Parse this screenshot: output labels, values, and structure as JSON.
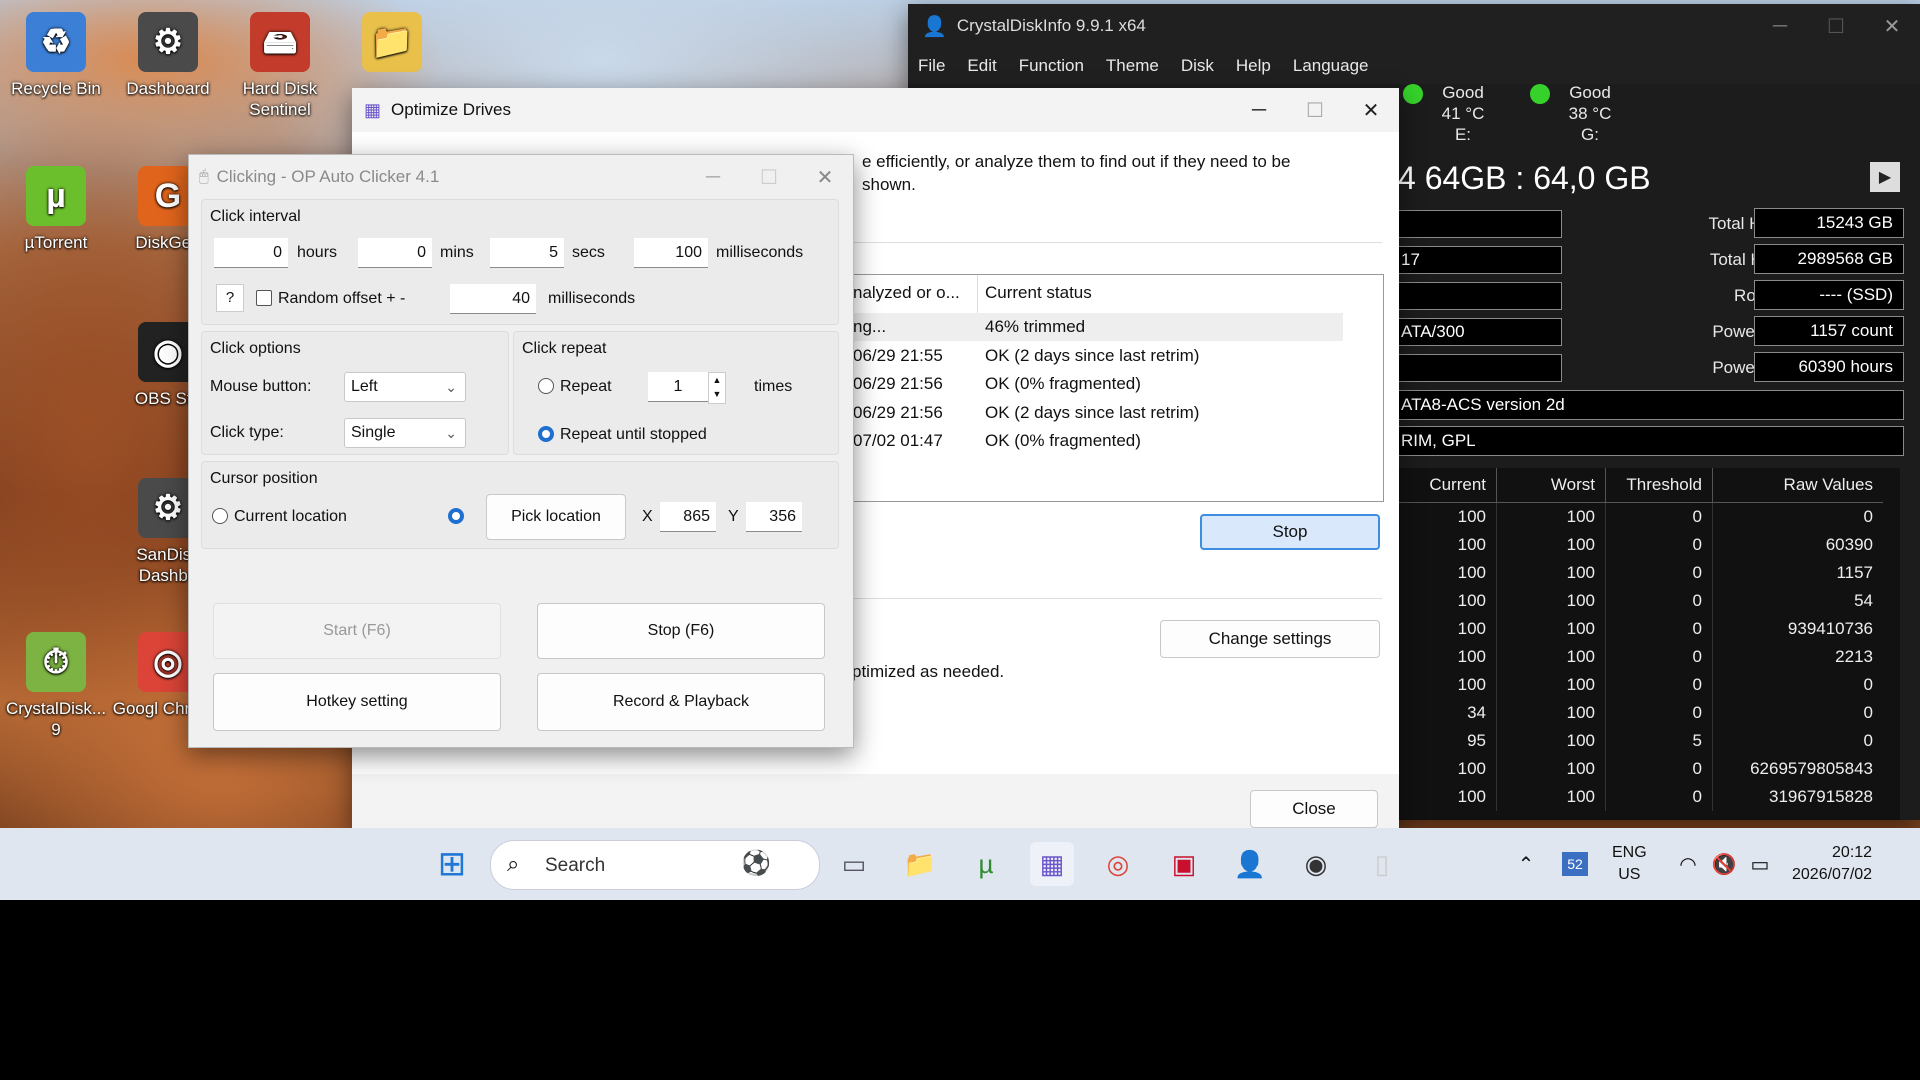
{
  "desktop": {
    "icons": [
      {
        "label": "Recycle Bin",
        "glyph": "♻",
        "color": "#3b7fd6"
      },
      {
        "label": "Dashboard",
        "glyph": "⚙",
        "color": "#4a4a4a"
      },
      {
        "label": "Hard Disk Sentinel",
        "glyph": "🖴",
        "color": "#c23b2b"
      },
      {
        "label": "",
        "glyph": "📁",
        "color": "#e8c04a"
      },
      {
        "label": "µTorrent",
        "glyph": "µ",
        "color": "#6cbf2c"
      },
      {
        "label": "DiskGen",
        "glyph": "G",
        "color": "#e0641c"
      },
      {
        "label": "OBS Stu",
        "glyph": "◉",
        "color": "#222222"
      },
      {
        "label": "SanDisk Dashbo",
        "glyph": "⚙",
        "color": "#4a4a4a"
      },
      {
        "label": "CrystalDisk... 9",
        "glyph": "⏱",
        "color": "#7cb342"
      },
      {
        "label": "Googl Chrome",
        "glyph": "◎",
        "color": "#db4437"
      }
    ]
  },
  "crystal": {
    "title": "CrystalDiskInfo 9.9.1 x64",
    "menu": [
      "File",
      "Edit",
      "Function",
      "Theme",
      "Disk",
      "Help",
      "Language"
    ],
    "drives": [
      {
        "status": "Good",
        "temp": "41 °C",
        "letter": "E:"
      },
      {
        "status": "Good",
        "temp": "38 °C",
        "letter": "G:"
      }
    ],
    "model": "4 64GB : 64,0 GB",
    "left_fields": [
      "",
      "17",
      "",
      "ATA/300",
      ""
    ],
    "stats": [
      {
        "label": "Total Host Reads",
        "value": "15243 GB"
      },
      {
        "label": "Total Host Writes",
        "value": "2989568 GB"
      },
      {
        "label": "Rotation Rate",
        "value": "---- (SSD)"
      },
      {
        "label": "Power On Count",
        "value": "1157 count"
      },
      {
        "label": "Power On Hours",
        "value": "60390 hours"
      }
    ],
    "standard": "ATA8-ACS version 2d",
    "features": "RIM, GPL",
    "smart_headers": [
      "Current",
      "Worst",
      "Threshold",
      "Raw Values"
    ],
    "smart_rows": [
      [
        "100",
        "100",
        "0",
        "0"
      ],
      [
        "100",
        "100",
        "0",
        "60390"
      ],
      [
        "100",
        "100",
        "0",
        "1157"
      ],
      [
        "100",
        "100",
        "0",
        "54"
      ],
      [
        "100",
        "100",
        "0",
        "939410736"
      ],
      [
        "100",
        "100",
        "0",
        "2213"
      ],
      [
        "100",
        "100",
        "0",
        "0"
      ],
      [
        "34",
        "100",
        "0",
        "0"
      ],
      [
        "95",
        "100",
        "5",
        "0"
      ],
      [
        "100",
        "100",
        "0",
        "6269579805843"
      ],
      [
        "100",
        "100",
        "0",
        "31967915828"
      ]
    ]
  },
  "optimize": {
    "title": "Optimize Drives",
    "desc_line1": "e efficiently, or analyze them to find out if they need to be",
    "desc_line2": "shown.",
    "col_last": "nalyzed or o...",
    "col_status": "Current status",
    "rows": [
      {
        "date": "ng...",
        "status": "46% trimmed"
      },
      {
        "date": "06/29 21:55",
        "status": "OK (2 days since last retrim)"
      },
      {
        "date": "06/29 21:56",
        "status": "OK (0% fragmented)"
      },
      {
        "date": "06/29 21:56",
        "status": "OK (2 days since last retrim)"
      },
      {
        "date": "07/02 01:47",
        "status": "OK (0% fragmented)"
      }
    ],
    "stop_label": "Stop",
    "change_settings_label": "Change settings",
    "scheduled_text": "ptimized as needed.",
    "close_label": "Close"
  },
  "clicker": {
    "title": "Clicking - OP Auto Clicker 4.1",
    "interval_title": "Click interval",
    "hours": "0",
    "hours_lbl": "hours",
    "mins": "0",
    "mins_lbl": "mins",
    "secs": "5",
    "secs_lbl": "secs",
    "ms": "100",
    "ms_lbl": "milliseconds",
    "help": "?",
    "random_lbl": "Random offset + -",
    "random_ms": "40",
    "random_ms_lbl": "milliseconds",
    "options_title": "Click options",
    "mouse_btn_lbl": "Mouse button:",
    "mouse_btn": "Left",
    "click_type_lbl": "Click type:",
    "click_type": "Single",
    "repeat_title": "Click repeat",
    "repeat_lbl": "Repeat",
    "repeat_times": "1",
    "times_lbl": "times",
    "repeat_until_lbl": "Repeat until stopped",
    "cursor_title": "Cursor position",
    "current_loc_lbl": "Current location",
    "pick_loc_lbl": "Pick location",
    "x_lbl": "X",
    "x_val": "865",
    "y_lbl": "Y",
    "y_val": "356",
    "start_lbl": "Start (F6)",
    "stop_lbl": "Stop (F6)",
    "hotkey_lbl": "Hotkey setting",
    "record_lbl": "Record & Playback"
  },
  "taskbar": {
    "search_placeholder": "Search",
    "lang1": "ENG",
    "lang2": "US",
    "time": "20:12",
    "date": "2026/07/02",
    "badge": "52"
  }
}
